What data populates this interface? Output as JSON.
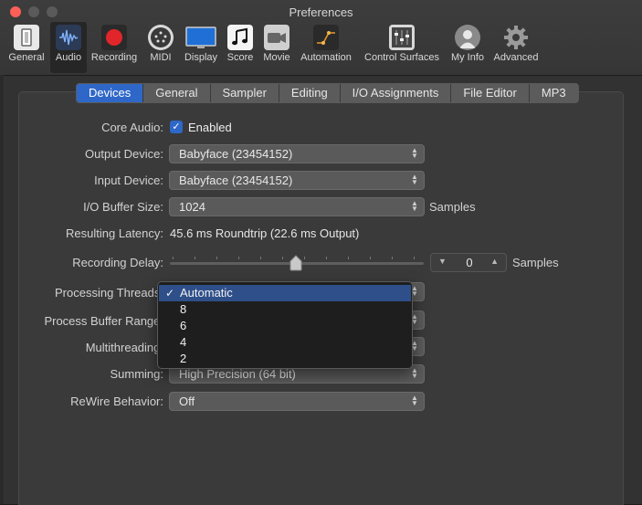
{
  "window": {
    "title": "Preferences"
  },
  "toolbar": {
    "items": [
      {
        "label": "General",
        "icon": "general-icon"
      },
      {
        "label": "Audio",
        "icon": "audio-waveform-icon"
      },
      {
        "label": "Recording",
        "icon": "record-icon"
      },
      {
        "label": "MIDI",
        "icon": "midi-connector-icon"
      },
      {
        "label": "Display",
        "icon": "display-monitor-icon"
      },
      {
        "label": "Score",
        "icon": "music-note-icon"
      },
      {
        "label": "Movie",
        "icon": "movie-camera-icon"
      },
      {
        "label": "Automation",
        "icon": "automation-curve-icon"
      },
      {
        "label": "Control Surfaces",
        "icon": "faders-icon"
      },
      {
        "label": "My Info",
        "icon": "user-avatar-icon"
      },
      {
        "label": "Advanced",
        "icon": "gear-icon"
      }
    ],
    "selected": "Audio"
  },
  "tabs": [
    {
      "label": "Devices"
    },
    {
      "label": "General"
    },
    {
      "label": "Sampler"
    },
    {
      "label": "Editing"
    },
    {
      "label": "I/O Assignments"
    },
    {
      "label": "File Editor"
    },
    {
      "label": "MP3"
    }
  ],
  "active_tab": "Devices",
  "settings": {
    "core_audio": {
      "label": "Core Audio:",
      "checkbox_label": "Enabled",
      "checked": true
    },
    "output_device": {
      "label": "Output Device:",
      "value": "Babyface (23454152)"
    },
    "input_device": {
      "label": "Input Device:",
      "value": "Babyface (23454152)"
    },
    "io_buffer_size": {
      "label": "I/O Buffer Size:",
      "value": "1024",
      "unit": "Samples"
    },
    "resulting_latency": {
      "label": "Resulting Latency:",
      "value": "45.6 ms Roundtrip (22.6 ms Output)"
    },
    "recording_delay": {
      "label": "Recording Delay:",
      "value": "0",
      "unit": "Samples",
      "slider_fraction": 0.5
    },
    "processing_threads": {
      "label": "Processing Threads:"
    },
    "process_buffer_range": {
      "label": "Process Buffer Range:"
    },
    "multithreading": {
      "label": "Multithreading:"
    },
    "summing": {
      "label": "Summing:",
      "value": "High Precision (64 bit)"
    },
    "rewire_behavior": {
      "label": "ReWire Behavior:",
      "value": "Off"
    }
  },
  "threads_menu": {
    "options": [
      "Automatic",
      "8",
      "6",
      "4",
      "2"
    ],
    "selected": "Automatic"
  },
  "colors": {
    "accent": "#2e67c8",
    "record_red": "#e0262a",
    "menu_highlight": "#2e4f89"
  }
}
